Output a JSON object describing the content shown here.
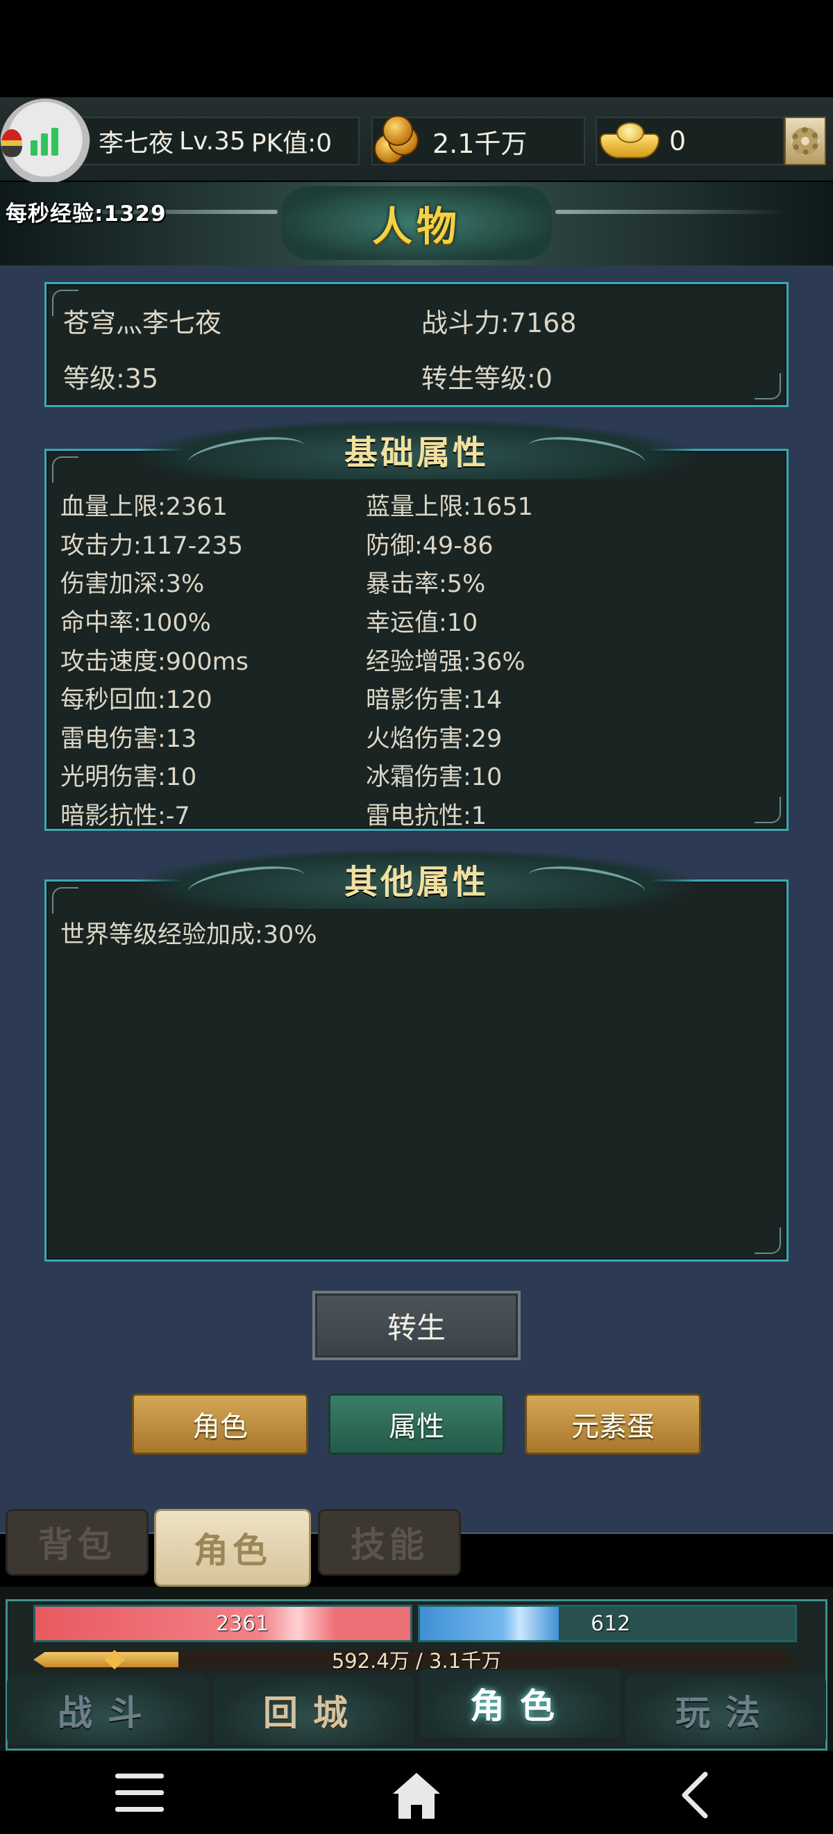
{
  "top_bar": {
    "player_name": "李七夜",
    "level": "Lv.35",
    "pk_label": "PK值:0",
    "gold_value": "2.1千万",
    "ingot_value": "0",
    "exp_per_second": "每秒经验:1329",
    "icons": [
      "stats-chart-icon",
      "gold-coin-icon",
      "gold-ingot-icon",
      "gear-icon"
    ]
  },
  "page": {
    "title": "人物"
  },
  "info": {
    "name": "苍穹灬李七夜",
    "combat_power": "战斗力:7168",
    "level": "等级:35",
    "rebirth_level": "转生等级:0"
  },
  "basic_attrs": {
    "title": "基础属性",
    "items": [
      "血量上限:2361",
      "蓝量上限:1651",
      "攻击力:117-235",
      "防御:49-86",
      "伤害加深:3%",
      "暴击率:5%",
      "命中率:100%",
      "幸运值:10",
      "攻击速度:900ms",
      "经验增强:36%",
      "每秒回血:120",
      "暗影伤害:14",
      "雷电伤害:13",
      "火焰伤害:29",
      "光明伤害:10",
      "冰霜伤害:10",
      "暗影抗性:-7",
      "雷电抗性:1"
    ]
  },
  "other_attrs": {
    "title": "其他属性",
    "items": [
      "世界等级经验加成:30%"
    ]
  },
  "rebirth_button": "转生",
  "sub_tabs": [
    "角色",
    "属性",
    "元素蛋"
  ],
  "active_sub_tab": "属性",
  "bottom_tabs": [
    "背包",
    "角色",
    "技能"
  ],
  "active_bottom_tab": "角色",
  "hud": {
    "hp": "2361",
    "hp_fraction": 1.0,
    "mp": "612",
    "mp_fraction": 0.37,
    "exp": "592.4万 / 3.1千万",
    "exp_fraction": 0.19
  },
  "main_nav": [
    "战斗",
    "回城",
    "角色",
    "玩法"
  ],
  "active_main_nav": "角色",
  "colors": {
    "frame_border": "#3aa9b5",
    "title_gold": "#f2d246",
    "panel_bg": "#2c3b53",
    "hp": "#e85a60",
    "mp": "#3f8fd3"
  }
}
